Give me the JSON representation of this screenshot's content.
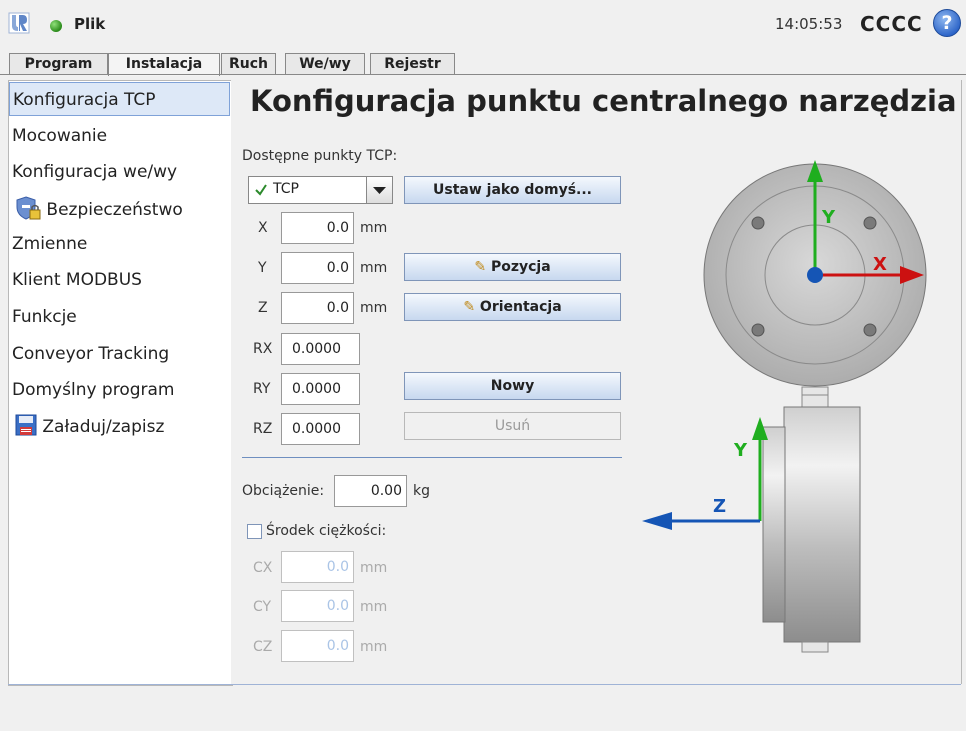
{
  "header": {
    "file_menu": "Plik",
    "clock": "14:05:53",
    "robot_name": "CCCC",
    "help_icon": "?"
  },
  "tabs": [
    "Program",
    "Instalacja",
    "Ruch",
    "We/wy",
    "Rejestr"
  ],
  "sidebar": {
    "items": [
      {
        "label": "Konfiguracja TCP"
      },
      {
        "label": "Mocowanie"
      },
      {
        "label": "Konfiguracja we/wy"
      },
      {
        "label": "Bezpieczeństwo"
      },
      {
        "label": "Zmienne"
      },
      {
        "label": "Klient MODBUS"
      },
      {
        "label": "Funkcje"
      },
      {
        "label": "Conveyor Tracking"
      },
      {
        "label": "Domyślny program"
      },
      {
        "label": "Załaduj/zapisz"
      }
    ]
  },
  "main": {
    "title": "Konfiguracja punktu centralnego narzędzia",
    "tcp_label": "Dostępne punkty TCP:",
    "tcp_selected": "TCP",
    "set_default_button": "Ustaw jako domyś...",
    "position_button": "Pozycja",
    "orientation_button": "Orientacja",
    "new_button": "Nowy",
    "delete_button": "Usuń",
    "unit_mm": "mm",
    "fields": {
      "x": {
        "label": "X",
        "value": "0.0"
      },
      "y": {
        "label": "Y",
        "value": "0.0"
      },
      "z": {
        "label": "Z",
        "value": "0.0"
      },
      "rx": {
        "label": "RX",
        "value": "0.0000"
      },
      "ry": {
        "label": "RY",
        "value": "0.0000"
      },
      "rz": {
        "label": "RZ",
        "value": "0.0000"
      }
    },
    "payload_label": "Obciążenie:",
    "payload_value": "0.00",
    "payload_unit": "kg",
    "cog_label": "Środek ciężkości:",
    "cog_fields": {
      "cx": {
        "label": "CX",
        "value": "0.0"
      },
      "cy": {
        "label": "CY",
        "value": "0.0"
      },
      "cz": {
        "label": "CZ",
        "value": "0.0"
      }
    }
  },
  "diagram": {
    "axis_x": "X",
    "axis_y": "Y",
    "axis_y2": "Y",
    "axis_z": "Z",
    "colors": {
      "x": "#cc1111",
      "y": "#1fae1f",
      "z": "#1555b5"
    }
  }
}
